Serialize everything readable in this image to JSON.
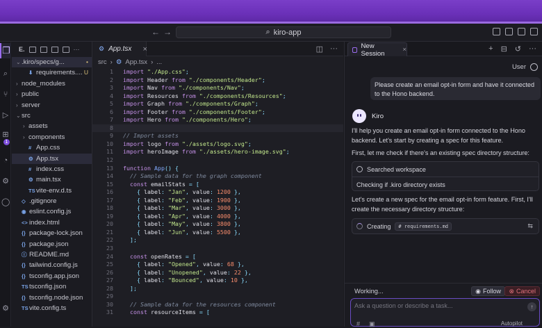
{
  "window": {
    "search_text": "kiro-app"
  },
  "explorer": {
    "items": [
      {
        "label": ".kiro/specs/g...",
        "indent": 0,
        "chev": "⌄",
        "icon": "",
        "mark": "•",
        "selected": true
      },
      {
        "label": "requirements....",
        "indent": 1,
        "chev": "",
        "icon": "⬇",
        "mark": "U"
      },
      {
        "label": "node_modules",
        "indent": 0,
        "chev": "›",
        "icon": ""
      },
      {
        "label": "public",
        "indent": 0,
        "chev": "›",
        "icon": ""
      },
      {
        "label": "server",
        "indent": 0,
        "chev": "›",
        "icon": ""
      },
      {
        "label": "src",
        "indent": 0,
        "chev": "⌄",
        "icon": ""
      },
      {
        "label": "assets",
        "indent": 1,
        "chev": "›",
        "icon": ""
      },
      {
        "label": "components",
        "indent": 1,
        "chev": "›",
        "icon": ""
      },
      {
        "label": "App.css",
        "indent": 1,
        "chev": "",
        "icon": "#"
      },
      {
        "label": "App.tsx",
        "indent": 1,
        "chev": "",
        "icon": "⚙",
        "selected": true
      },
      {
        "label": "index.css",
        "indent": 1,
        "chev": "",
        "icon": "#"
      },
      {
        "label": "main.tsx",
        "indent": 1,
        "chev": "",
        "icon": "⚙"
      },
      {
        "label": "vite-env.d.ts",
        "indent": 1,
        "chev": "",
        "icon": "TS"
      },
      {
        "label": ".gitignore",
        "indent": 0,
        "chev": "",
        "icon": "◇"
      },
      {
        "label": "eslint.config.js",
        "indent": 0,
        "chev": "",
        "icon": "◉"
      },
      {
        "label": "index.html",
        "indent": 0,
        "chev": "",
        "icon": "<>"
      },
      {
        "label": "package-lock.json",
        "indent": 0,
        "chev": "",
        "icon": "{}"
      },
      {
        "label": "package.json",
        "indent": 0,
        "chev": "",
        "icon": "{}"
      },
      {
        "label": "README.md",
        "indent": 0,
        "chev": "",
        "icon": "ⓘ"
      },
      {
        "label": "tailwind.config.js",
        "indent": 0,
        "chev": "",
        "icon": "{}"
      },
      {
        "label": "tsconfig.app.json",
        "indent": 0,
        "chev": "",
        "icon": "{}"
      },
      {
        "label": "tsconfig.json",
        "indent": 0,
        "chev": "",
        "icon": "TS"
      },
      {
        "label": "tsconfig.node.json",
        "indent": 0,
        "chev": "",
        "icon": "{}"
      },
      {
        "label": "vite.config.ts",
        "indent": 0,
        "chev": "",
        "icon": "TS"
      }
    ]
  },
  "editor": {
    "tab_label": "App.tsx",
    "breadcrumb": [
      "src",
      "App.tsx",
      "..."
    ],
    "lines": [
      [
        [
          "kw",
          "import "
        ],
        [
          "st",
          "\"./App.css\""
        ],
        [
          "pn",
          ";"
        ]
      ],
      [
        [
          "kw",
          "import "
        ],
        [
          "id",
          "Header "
        ],
        [
          "kw",
          "from "
        ],
        [
          "st",
          "\"./components/Header\""
        ],
        [
          "pn",
          ";"
        ]
      ],
      [
        [
          "kw",
          "import "
        ],
        [
          "id",
          "Nav "
        ],
        [
          "kw",
          "from "
        ],
        [
          "st",
          "\"./components/Nav\""
        ],
        [
          "pn",
          ";"
        ]
      ],
      [
        [
          "kw",
          "import "
        ],
        [
          "id",
          "Resources "
        ],
        [
          "kw",
          "from "
        ],
        [
          "st",
          "\"./components/Resources\""
        ],
        [
          "pn",
          ";"
        ]
      ],
      [
        [
          "kw",
          "import "
        ],
        [
          "id",
          "Graph "
        ],
        [
          "kw",
          "from "
        ],
        [
          "st",
          "\"./components/Graph\""
        ],
        [
          "pn",
          ";"
        ]
      ],
      [
        [
          "kw",
          "import "
        ],
        [
          "id",
          "Footer "
        ],
        [
          "kw",
          "from "
        ],
        [
          "st",
          "\"./components/Footer\""
        ],
        [
          "pn",
          ";"
        ]
      ],
      [
        [
          "kw",
          "import "
        ],
        [
          "id",
          "Hero "
        ],
        [
          "kw",
          "from "
        ],
        [
          "st",
          "\"./components/Hero\""
        ],
        [
          "pn",
          ";"
        ]
      ],
      [],
      [
        [
          "cm",
          "// Import assets"
        ]
      ],
      [
        [
          "kw",
          "import "
        ],
        [
          "id",
          "logo "
        ],
        [
          "kw",
          "from "
        ],
        [
          "st",
          "\"./assets/logo.svg\""
        ],
        [
          "pn",
          ";"
        ]
      ],
      [
        [
          "kw",
          "import "
        ],
        [
          "id",
          "heroImage "
        ],
        [
          "kw",
          "from "
        ],
        [
          "st",
          "\"./assets/hero-image.svg\""
        ],
        [
          "pn",
          ";"
        ]
      ],
      [],
      [
        [
          "kw",
          "function "
        ],
        [
          "pr",
          "App"
        ],
        [
          "pn",
          "() {"
        ]
      ],
      [
        [
          "cm",
          "  // Sample data for the graph component"
        ]
      ],
      [
        [
          "kw",
          "  const "
        ],
        [
          "id",
          "emailStats "
        ],
        [
          "pn",
          "= ["
        ]
      ],
      [
        [
          "pn",
          "    { "
        ],
        [
          "id",
          "label"
        ],
        [
          "pn",
          ": "
        ],
        [
          "st",
          "\"Jan\""
        ],
        [
          "pn",
          ", "
        ],
        [
          "id",
          "value"
        ],
        [
          "pn",
          ": "
        ],
        [
          "nm",
          "1200"
        ],
        [
          "pn",
          " },"
        ]
      ],
      [
        [
          "pn",
          "    { "
        ],
        [
          "id",
          "label"
        ],
        [
          "pn",
          ": "
        ],
        [
          "st",
          "\"Feb\""
        ],
        [
          "pn",
          ", "
        ],
        [
          "id",
          "value"
        ],
        [
          "pn",
          ": "
        ],
        [
          "nm",
          "1900"
        ],
        [
          "pn",
          " },"
        ]
      ],
      [
        [
          "pn",
          "    { "
        ],
        [
          "id",
          "label"
        ],
        [
          "pn",
          ": "
        ],
        [
          "st",
          "\"Mar\""
        ],
        [
          "pn",
          ", "
        ],
        [
          "id",
          "value"
        ],
        [
          "pn",
          ": "
        ],
        [
          "nm",
          "3000"
        ],
        [
          "pn",
          " },"
        ]
      ],
      [
        [
          "pn",
          "    { "
        ],
        [
          "id",
          "label"
        ],
        [
          "pn",
          ": "
        ],
        [
          "st",
          "\"Apr\""
        ],
        [
          "pn",
          ", "
        ],
        [
          "id",
          "value"
        ],
        [
          "pn",
          ": "
        ],
        [
          "nm",
          "4000"
        ],
        [
          "pn",
          " },"
        ]
      ],
      [
        [
          "pn",
          "    { "
        ],
        [
          "id",
          "label"
        ],
        [
          "pn",
          ": "
        ],
        [
          "st",
          "\"May\""
        ],
        [
          "pn",
          ", "
        ],
        [
          "id",
          "value"
        ],
        [
          "pn",
          ": "
        ],
        [
          "nm",
          "3800"
        ],
        [
          "pn",
          " },"
        ]
      ],
      [
        [
          "pn",
          "    { "
        ],
        [
          "id",
          "label"
        ],
        [
          "pn",
          ": "
        ],
        [
          "st",
          "\"Jun\""
        ],
        [
          "pn",
          ", "
        ],
        [
          "id",
          "value"
        ],
        [
          "pn",
          ": "
        ],
        [
          "nm",
          "5500"
        ],
        [
          "pn",
          " },"
        ]
      ],
      [
        [
          "pn",
          "  ];"
        ]
      ],
      [],
      [
        [
          "kw",
          "  const "
        ],
        [
          "id",
          "openRates "
        ],
        [
          "pn",
          "= ["
        ]
      ],
      [
        [
          "pn",
          "    { "
        ],
        [
          "id",
          "label"
        ],
        [
          "pn",
          ": "
        ],
        [
          "st",
          "\"Opened\""
        ],
        [
          "pn",
          ", "
        ],
        [
          "id",
          "value"
        ],
        [
          "pn",
          ": "
        ],
        [
          "nm",
          "68"
        ],
        [
          "pn",
          " },"
        ]
      ],
      [
        [
          "pn",
          "    { "
        ],
        [
          "id",
          "label"
        ],
        [
          "pn",
          ": "
        ],
        [
          "st",
          "\"Unopened\""
        ],
        [
          "pn",
          ", "
        ],
        [
          "id",
          "value"
        ],
        [
          "pn",
          ": "
        ],
        [
          "nm",
          "22"
        ],
        [
          "pn",
          " },"
        ]
      ],
      [
        [
          "pn",
          "    { "
        ],
        [
          "id",
          "label"
        ],
        [
          "pn",
          ": "
        ],
        [
          "st",
          "\"Bounced\""
        ],
        [
          "pn",
          ", "
        ],
        [
          "id",
          "value"
        ],
        [
          "pn",
          ": "
        ],
        [
          "nm",
          "10"
        ],
        [
          "pn",
          " },"
        ]
      ],
      [
        [
          "pn",
          "  ];"
        ]
      ],
      [],
      [
        [
          "cm",
          "  // Sample data for the resources component"
        ]
      ],
      [
        [
          "kw",
          "  const "
        ],
        [
          "id",
          "resourceItems "
        ],
        [
          "pn",
          "= ["
        ]
      ]
    ],
    "current_line": 8
  },
  "chat": {
    "tab_label": "New Session",
    "user_label": "User",
    "user_message": "Please create an email opt-in form and have it connected to the Hono backend.",
    "assistant_name": "Kiro",
    "msg1": "I'll help you create an email opt-in form connected to the Hono backend. Let's start by creating a spec for this feature.",
    "msg2": "First, let me check if there's an existing spec directory structure:",
    "tool_title": "Searched workspace",
    "tool_detail": "Checking if .kiro directory exists",
    "msg3": "Let's create a new spec for the email opt-in form feature. First, I'll create the necessary directory structure:",
    "creating_label": "Creating",
    "creating_file": "# requirements.md",
    "working_label": "Working...",
    "follow_label": "Follow",
    "cancel_label": "Cancel",
    "input_placeholder": "Ask a question or describe a task...",
    "autopilot_label": "Autopilot"
  }
}
